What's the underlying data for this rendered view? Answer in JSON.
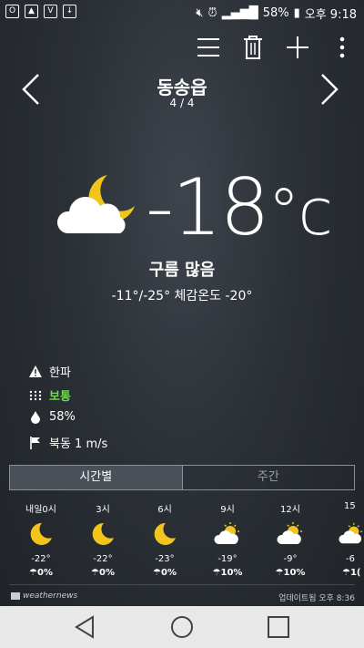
{
  "status_bar": {
    "battery": "58%",
    "time": "오후 9:18"
  },
  "location": {
    "city": "동송읍",
    "pager": "4 / 4"
  },
  "current": {
    "temperature": "-18",
    "unit": "°c",
    "condition": "구름 많음",
    "range_feels": "-11°/-25° 체감온도 -20°"
  },
  "details": {
    "warning": "한파",
    "air": "보통",
    "humidity": "58%",
    "wind": "북동 1 m/s"
  },
  "colors": {
    "air_quality": "#6fdc4a",
    "moon": "#f2c51d"
  },
  "tabs": {
    "hourly": "시간별",
    "weekly": "주간"
  },
  "hourly": [
    {
      "time": "내일0시",
      "icon": "moon-icon",
      "temp": "-22°",
      "rain": "0%"
    },
    {
      "time": "3시",
      "icon": "moon-icon",
      "temp": "-22°",
      "rain": "0%"
    },
    {
      "time": "6시",
      "icon": "moon-icon",
      "temp": "-23°",
      "rain": "0%"
    },
    {
      "time": "9시",
      "icon": "sun-cloud-icon",
      "temp": "-19°",
      "rain": "10%"
    },
    {
      "time": "12시",
      "icon": "sun-cloud-icon",
      "temp": "-9°",
      "rain": "10%"
    },
    {
      "time": "15",
      "icon": "sun-cloud-icon",
      "temp": "-6",
      "rain": "1("
    }
  ],
  "footer": {
    "brand": "weathernews",
    "updated": "업데이트됨 오후 8:36"
  }
}
